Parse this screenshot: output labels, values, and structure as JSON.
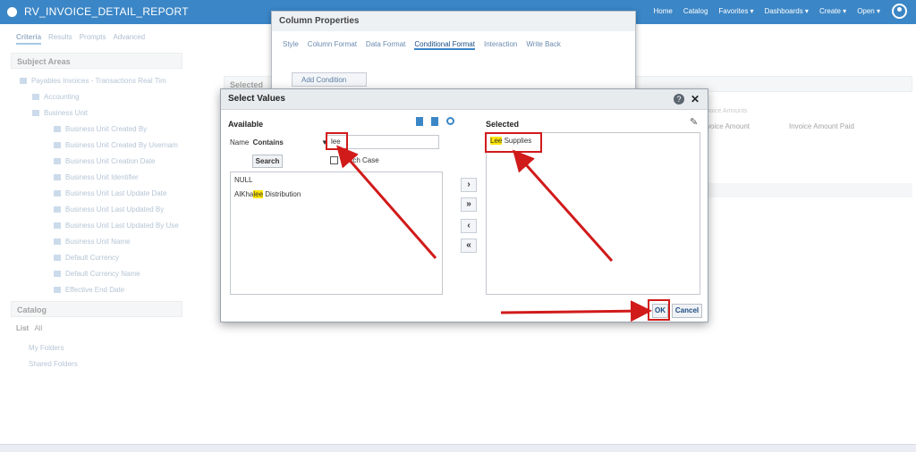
{
  "topbar": {
    "title": "RV_INVOICE_DETAIL_REPORT",
    "nav": [
      "Home",
      "Catalog",
      "Favorites ▾",
      "Dashboards ▾",
      "Create ▾",
      "Open ▾"
    ]
  },
  "tabs": [
    "Criteria",
    "Results",
    "Prompts",
    "Advanced"
  ],
  "subject_areas": {
    "title": "Subject Areas",
    "items": [
      "Payables Invoices - Transactions Real Tim",
      "Accounting",
      "Business Unit",
      "Business Unit Created By",
      "Business Unit Created By Usernam",
      "Business Unit Creation Date",
      "Business Unit Identifier",
      "Business Unit Last Update Date",
      "Business Unit Last Updated By",
      "Business Unit Last Updated By Use",
      "Business Unit Name",
      "Default Currency",
      "Default Currency Name",
      "Effective End Date"
    ]
  },
  "catalog": {
    "title": "Catalog",
    "list_label": "List",
    "list_value": "All",
    "items": [
      "My Folders",
      "Shared Folders"
    ]
  },
  "selected_columns_label": "Selected",
  "background_columns": {
    "group": "voice Amounts",
    "col1": "voice Amount",
    "col2": "Invoice Amount Paid"
  },
  "column_properties": {
    "title": "Column Properties",
    "tabs": [
      "Style",
      "Column Format",
      "Data Format",
      "Conditional Format",
      "Interaction",
      "Write Back"
    ],
    "add_condition": "Add Condition"
  },
  "select_values": {
    "title": "Select Values",
    "available_label": "Available",
    "selected_label": "Selected",
    "filter_field_label": "Name",
    "filter_operator": "Contains",
    "search_value": "lee",
    "search_button": "Search",
    "match_case_label": "Match Case",
    "available_items": [
      "NULL",
      "AlKhalee Distribution"
    ],
    "available_item_parts": {
      "prefix": "AlKha",
      "hl": "lee",
      "suffix": " Distribution"
    },
    "selected_items": [
      "Lee Supplies"
    ],
    "selected_item_parts": {
      "hl": "Lee",
      "suffix": " Supplies"
    },
    "ok_label": "OK",
    "cancel_label": "Cancel"
  },
  "colors": {
    "accent": "#3b86c6",
    "highlight": "#ffe600",
    "annotation": "#d11a1a"
  }
}
